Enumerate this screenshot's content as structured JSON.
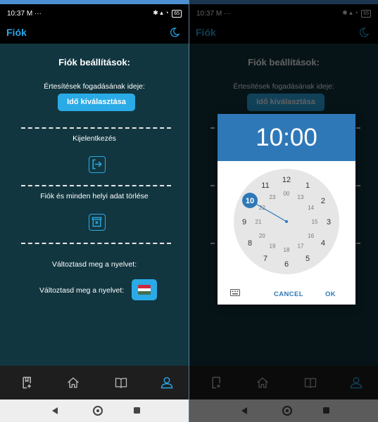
{
  "status": {
    "time": "10:37",
    "notif": "M ···",
    "battery": "65"
  },
  "appbar": {
    "title": "Fiók"
  },
  "settings": {
    "heading": "Fiók beállítások:",
    "notify_time_label": "Értesítések fogadásának ideje:",
    "pick_time_button": "Idő kiválasztása",
    "logout_label": "Kijelentkezés",
    "delete_label": "Fiók és minden helyi adat törlése",
    "language_title": "Változtasd meg a nyelvet:",
    "language_row_label": "Változtasd meg a nyelvet:"
  },
  "timepicker": {
    "time": "10:00",
    "selected_hour": "10",
    "outer_hours": [
      "12",
      "1",
      "2",
      "3",
      "4",
      "5",
      "6",
      "7",
      "8",
      "9",
      "10",
      "11"
    ],
    "inner_hours": [
      "00",
      "13",
      "14",
      "15",
      "16",
      "17",
      "18",
      "19",
      "20",
      "21",
      "22",
      "23"
    ],
    "cancel_label": "CANCEL",
    "ok_label": "OK"
  },
  "navbar": {
    "items": [
      "library-icon",
      "home-icon",
      "book-icon",
      "account-icon"
    ],
    "active": "account-icon"
  },
  "colors": {
    "accent": "#2aaae6",
    "appbar_title": "#28a8ea",
    "background": "#123640",
    "dialog_header": "#2f78b8",
    "flag_red": "#cd2a3e",
    "flag_white": "#ffffff",
    "flag_green": "#436f4d"
  }
}
